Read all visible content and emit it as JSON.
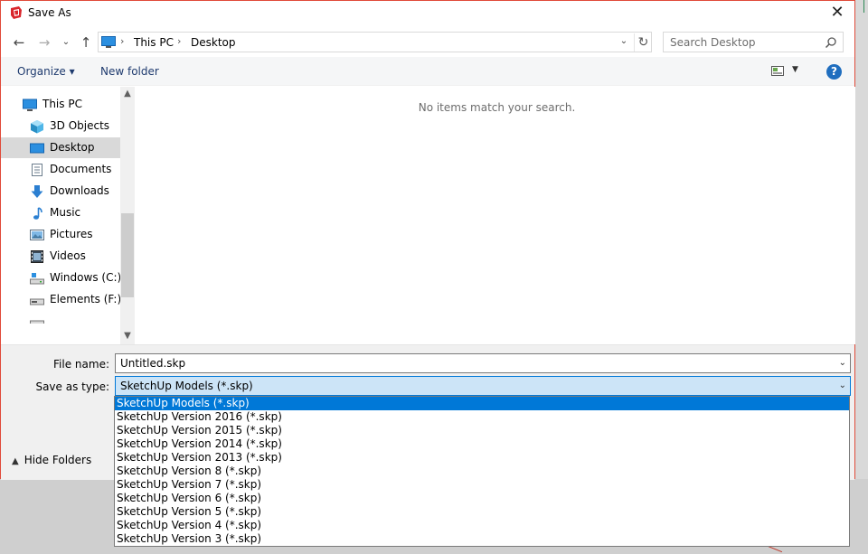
{
  "window": {
    "title": "Save As",
    "close_label": "✕"
  },
  "navigation": {
    "back_label": "←",
    "forward_label": "→",
    "recent_label": "⌄",
    "up_label": "↑",
    "breadcrumb": [
      "This PC",
      "Desktop"
    ],
    "separator": "›",
    "dropdown_label": "⌄",
    "refresh_label": "↻"
  },
  "search": {
    "placeholder": "Search Desktop"
  },
  "toolbar": {
    "organize_label": "Organize ▾",
    "new_folder_label": "New folder",
    "view_drop_label": "▼",
    "help_label": "?"
  },
  "sidebar": {
    "items": [
      {
        "label": "This PC",
        "icon": "computer-icon"
      },
      {
        "label": "3D Objects",
        "icon": "3d-objects-icon"
      },
      {
        "label": "Desktop",
        "icon": "desktop-icon",
        "selected": true
      },
      {
        "label": "Documents",
        "icon": "documents-icon"
      },
      {
        "label": "Downloads",
        "icon": "downloads-icon"
      },
      {
        "label": "Music",
        "icon": "music-icon"
      },
      {
        "label": "Pictures",
        "icon": "pictures-icon"
      },
      {
        "label": "Videos",
        "icon": "videos-icon"
      },
      {
        "label": "Windows (C:)",
        "icon": "drive-icon"
      },
      {
        "label": "Elements (F:)",
        "icon": "drive-icon"
      }
    ],
    "scroll_up": "▲",
    "scroll_down": "▼"
  },
  "main": {
    "empty_message": "No items match your search."
  },
  "form": {
    "file_name_label": "File name:",
    "file_name_value": "Untitled.skp",
    "save_type_label": "Save as type:",
    "save_type_value": "SketchUp Models (*.skp)",
    "dropdown_arrow": "⌄"
  },
  "hide_folders": {
    "chevron": "▲",
    "label": "Hide Folders"
  },
  "type_options": [
    "SketchUp Models (*.skp)",
    "SketchUp Version 2016 (*.skp)",
    "SketchUp Version 2015 (*.skp)",
    "SketchUp Version 2014 (*.skp)",
    "SketchUp Version 2013 (*.skp)",
    "SketchUp Version 8 (*.skp)",
    "SketchUp Version 7 (*.skp)",
    "SketchUp Version 6 (*.skp)",
    "SketchUp Version 5 (*.skp)",
    "SketchUp Version 4 (*.skp)",
    "SketchUp Version 3 (*.skp)"
  ],
  "colors": {
    "accent": "#0078d7",
    "dialog_border": "#e04a3a",
    "selected_nav": "#d9d9d9"
  }
}
